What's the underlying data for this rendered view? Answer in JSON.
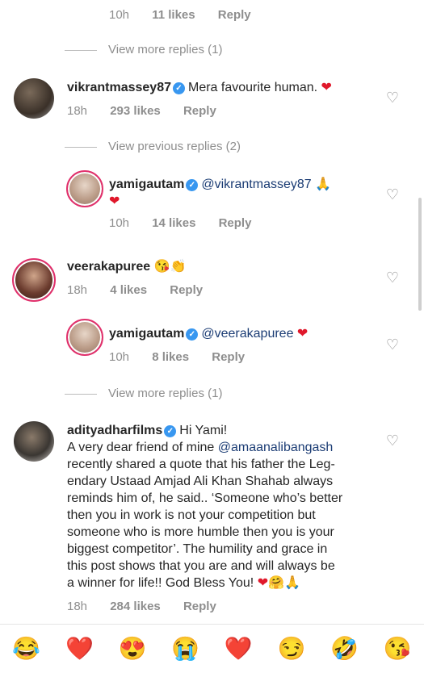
{
  "top_reply": {
    "time": "10h",
    "likes": "11 likes",
    "reply": "Reply"
  },
  "view_more_1": "View more replies (1)",
  "comment1": {
    "username": "vikrantmassey87",
    "text": "Mera favourite human. ",
    "heart": "❤",
    "time": "18h",
    "likes": "293 likes",
    "reply": "Reply"
  },
  "view_prev": "View previous replies (2)",
  "reply1": {
    "username": "yamigautam",
    "mention": "@vikrantmassey87",
    "text_emoji": "🙏",
    "heart": "❤",
    "time": "10h",
    "likes": "14 likes",
    "reply": "Reply"
  },
  "comment2": {
    "username": "veerakapuree",
    "emojis": "😘👏",
    "time": "18h",
    "likes": "4 likes",
    "reply": "Reply"
  },
  "reply2": {
    "username": "yamigautam",
    "mention": "@veerakapuree",
    "heart": "❤",
    "time": "10h",
    "likes": "8 likes",
    "reply": "Reply"
  },
  "view_more_2": "View more replies (1)",
  "comment3": {
    "username": "adityadharfilms",
    "greeting": "Hi Yami!",
    "line1_pre": "A very dear friend of mine ",
    "mention": "@amaanalibangash",
    "lines": [
      "recently shared a quote that his father the Leg-",
      "endary Ustaad Amjad Ali Khan Shahab always",
      "reminds him of, he said.. ‘Someone who’s better",
      "then you in work is not your competition but",
      "someone who is more humble then you is your",
      "biggest competitor’. The humility and grace in",
      "this post shows that you are and will always be"
    ],
    "last_line": "a winner for life!! God Bless You! ",
    "end_emojis": "❤🤗🙏",
    "time": "18h",
    "likes": "284 likes",
    "reply": "Reply"
  },
  "emoji_bar": [
    "😂",
    "❤️",
    "😍",
    "😭",
    "❤️",
    "😏",
    "🤣",
    "😘"
  ],
  "icons": {
    "like": "heart-outline-icon",
    "verified": "verified-badge-icon"
  },
  "colors": {
    "mention": "#1b3c74",
    "verified": "#3897f0",
    "heart": "#e0182b",
    "meta": "#8e8e8e"
  }
}
